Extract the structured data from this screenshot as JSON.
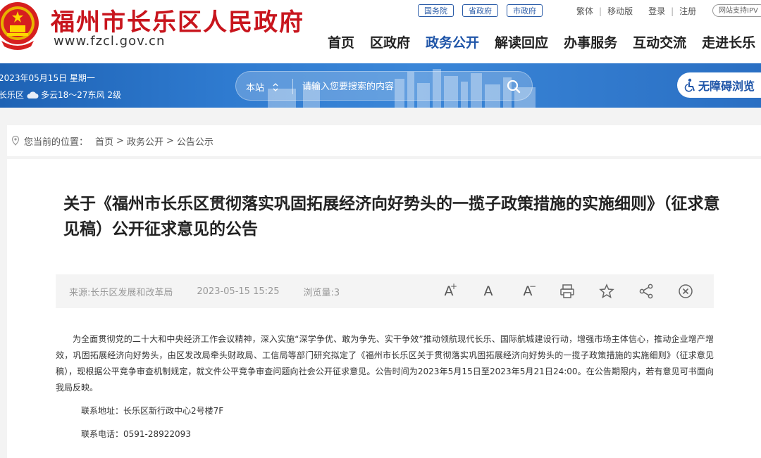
{
  "header": {
    "site_title": "福州市长乐区人民政府",
    "site_domain": "www.fzcl.gov.cn",
    "gov_links": [
      "国务院",
      "省政府",
      "市政府"
    ],
    "util_links": {
      "traditional": "繁体",
      "mobile": "移动版",
      "login": "登录",
      "register": "注册"
    },
    "ipv6_badge": "网站支持IPV",
    "nav": [
      "首页",
      "区政府",
      "政务公开",
      "解读回应",
      "办事服务",
      "互动交流",
      "走进长乐"
    ],
    "nav_active": "政务公开"
  },
  "banner": {
    "date": "2023年05月15日   星期一",
    "location": "长乐区",
    "weather": "多云18～27东风 2级",
    "search_scope": "本站",
    "search_placeholder": "请输入您要搜索的内容",
    "accessibility_label": "无障碍浏览"
  },
  "breadcrumb": {
    "prefix": "您当前的位置：",
    "items": [
      "首页",
      "政务公开",
      "公告公示"
    ]
  },
  "article": {
    "title": "关于《福州市长乐区贯彻落实巩固拓展经济向好势头的一揽子政策措施的实施细则》（征求意见稿）公开征求意见的公告",
    "source": "来源:长乐区发展和改革局",
    "date": "2023-05-15 15:25",
    "views": "浏览量:3",
    "paragraph": "为全面贯彻党的二十大和中央经济工作会议精神，深入实施“深学争优、敢为争先、实干争效”推动领航现代长乐、国际航城建设行动，增强市场主体信心，推动企业增产增效，巩固拓展经济向好势头，由区发改局牵头财政局、工信局等部门研究拟定了《福州市长乐区关于贯彻落实巩固拓展经济向好势头的一揽子政策措施的实施细则》（征求意见稿），现根据公平竞争审查机制规定，就文件公平竞争审查问题向社会公开征求意见。公告时间为2023年5月15日至2023年5月21日24:00。在公告期限内，若有意见可书面向我局反映。",
    "address": "联系地址：长乐区新行政中心2号楼7F",
    "phone": "联系电话：0591-28922093"
  },
  "colors": {
    "brand_red": "#c8151d",
    "nav_blue": "#1f55a8",
    "banner_blue": "#2f7bd0"
  },
  "icons": [
    "emblem-icon",
    "location-pin-icon",
    "cloud-icon",
    "search-icon",
    "accessibility-icon",
    "font-increase-icon",
    "font-default-icon",
    "font-decrease-icon",
    "print-icon",
    "star-icon",
    "share-icon",
    "close-icon"
  ]
}
